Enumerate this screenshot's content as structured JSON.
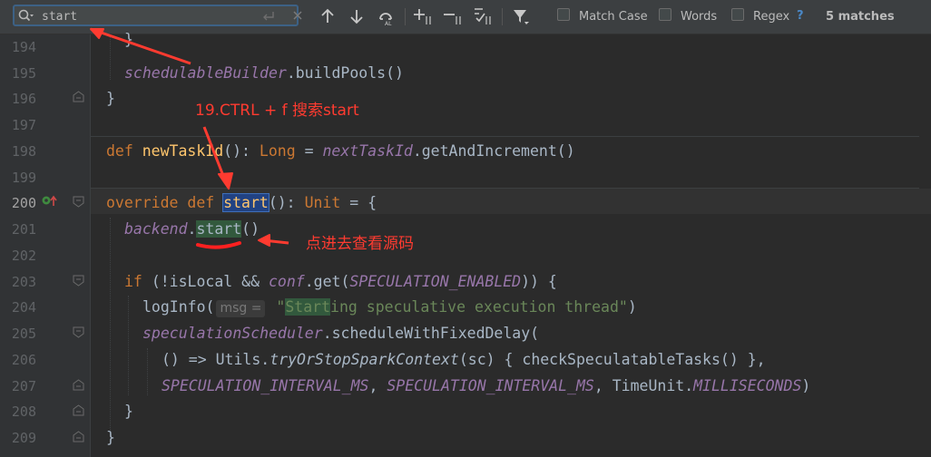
{
  "find_bar": {
    "query": "start",
    "match_case_label": "Match Case",
    "words_label": "Words",
    "regex_label": "Regex",
    "help_label": "?",
    "match_count": "5 matches"
  },
  "editor": {
    "line_numbers": [
      "194",
      "195",
      "196",
      "197",
      "198",
      "199",
      "200",
      "201",
      "202",
      "203",
      "204",
      "205",
      "206",
      "207",
      "208",
      "209"
    ],
    "lines": {
      "l195_obj": "schedulableBuilder",
      "l195_rest": ".buildPools()",
      "l196": "}",
      "l198_kw": "def ",
      "l198_fn": "newTaskId",
      "l198_mid": "(): ",
      "l198_type": "Long",
      "l198_eq": " = ",
      "l198_obj": "nextTaskId",
      "l198_rest": ".getAndIncrement()",
      "l200_kw": "override def ",
      "l200_fn": "start",
      "l200_mid": "(): ",
      "l200_type": "Unit",
      "l200_rest": " = {",
      "l201_obj": "backend",
      "l201_dot": ".",
      "l201_call": "start",
      "l201_rest": "()",
      "l203_kw": "if ",
      "l203_a": "(!isLocal && ",
      "l203_obj": "conf",
      "l203_b": ".get(",
      "l203_const": "SPECULATION_ENABLED",
      "l203_c": ")) {",
      "l204_a": "logInfo(",
      "l204_hint": "msg =",
      "l204_str_q": " \"",
      "l204_str_hl": "Start",
      "l204_str_rest": "ing speculative execution thread\"",
      "l204_b": ")",
      "l205_obj": "speculationScheduler",
      "l205_rest": ".scheduleWithFixedDelay(",
      "l206_a": "() => Utils.",
      "l206_fn": "tryOrStopSparkContext",
      "l206_b": "(sc) { checkSpeculatableTasks() },",
      "l207_c1": "SPECULATION_INTERVAL_MS",
      "l207_sep": ", ",
      "l207_c2": "SPECULATION_INTERVAL_MS",
      "l207_c3": "TimeUnit.",
      "l207_c4": "MILLISECONDS",
      "l207_end": ")",
      "l208": "}",
      "l209": "}"
    }
  },
  "annotations": {
    "step": "19.CTRL + f 搜索start",
    "note": "点进去查看源码"
  },
  "colors": {
    "annotation": "#ff3b30",
    "selection": "#214283",
    "find_match": "#32593d"
  }
}
